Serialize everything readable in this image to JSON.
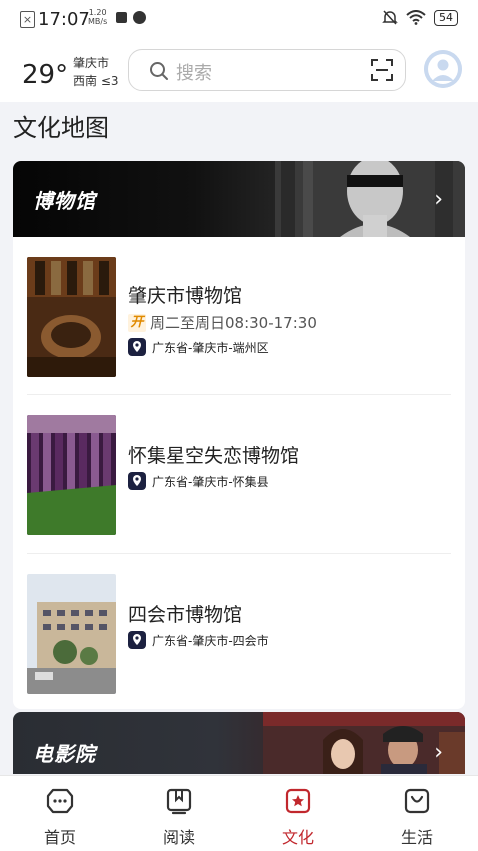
{
  "status_bar": {
    "time": "17:07",
    "net_speed_value": "1.20",
    "net_speed_unit": "MB/s",
    "battery": "54"
  },
  "header": {
    "temperature": "29°",
    "city": "肇庆市",
    "wind": "西南  ≤3",
    "search_placeholder": "搜索"
  },
  "page_title": "文化地图",
  "museum_section": {
    "title": "博物馆",
    "items": [
      {
        "name": "肇庆市博物馆",
        "open_badge": "开",
        "hours": "周二至周日08:30-17:30",
        "address": "广东省-肇庆市-端州区"
      },
      {
        "name": "怀集星空失恋博物馆",
        "address": "广东省-肇庆市-怀集县"
      },
      {
        "name": "四会市博物馆",
        "address": "广东省-肇庆市-四会市"
      }
    ]
  },
  "cinema_section": {
    "title": "电影院"
  },
  "tabbar": {
    "tabs": [
      {
        "label": "首页",
        "icon": "home-chat-icon"
      },
      {
        "label": "阅读",
        "icon": "book-icon"
      },
      {
        "label": "文化",
        "icon": "culture-star-icon"
      },
      {
        "label": "生活",
        "icon": "shopping-bag-icon"
      }
    ]
  },
  "colors": {
    "accent": "#c1272d",
    "banner_dark": "#0a0a0a",
    "pin_badge": "#1c2140",
    "open_badge": "#e08a00"
  }
}
